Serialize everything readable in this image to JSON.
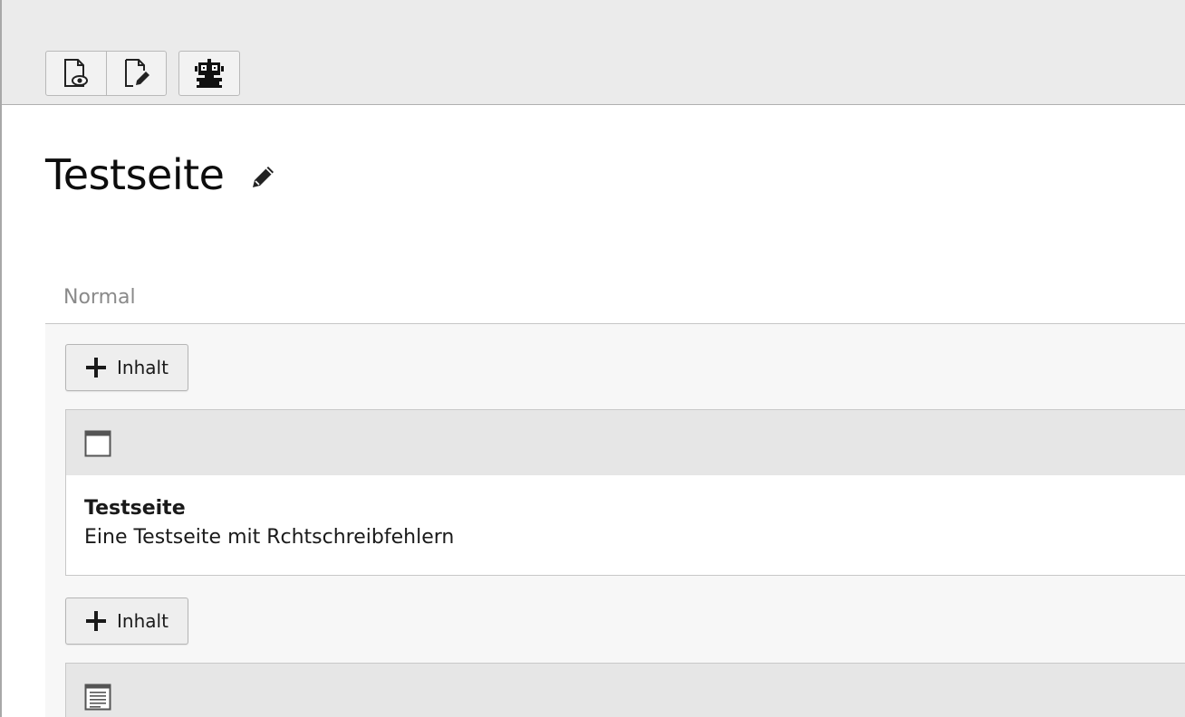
{
  "toolbar": {
    "buttons": [
      {
        "icon": "document-view-icon"
      },
      {
        "icon": "document-edit-icon"
      },
      {
        "icon": "robot-icon"
      }
    ]
  },
  "page": {
    "title": "Testseite",
    "edit_icon": "pencil-icon"
  },
  "column": {
    "name": "Normal",
    "add_label": "Inhalt",
    "elements": [
      {
        "icon": "header-element-icon",
        "header": "Testseite",
        "text": "Eine Testseite mit Rchtschreibfehlern"
      },
      {
        "icon": "text-element-icon"
      }
    ]
  }
}
